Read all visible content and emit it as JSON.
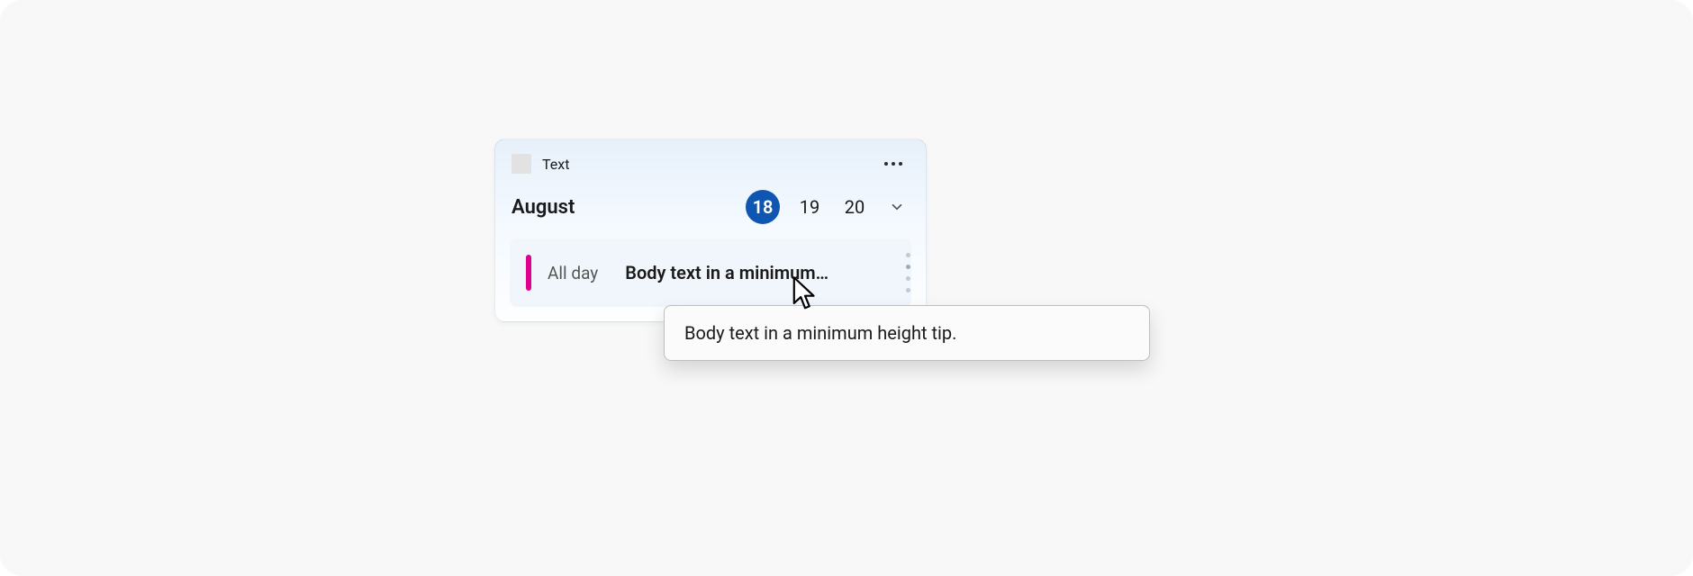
{
  "card": {
    "header_label": "Text",
    "month": "August",
    "dates": [
      "18",
      "19",
      "20"
    ],
    "selected_index": 0
  },
  "event": {
    "when": "All day",
    "title": "Body text in a minimum…",
    "accent_color": "#e3008c"
  },
  "tooltip": {
    "text": "Body text in a minimum height tip."
  }
}
